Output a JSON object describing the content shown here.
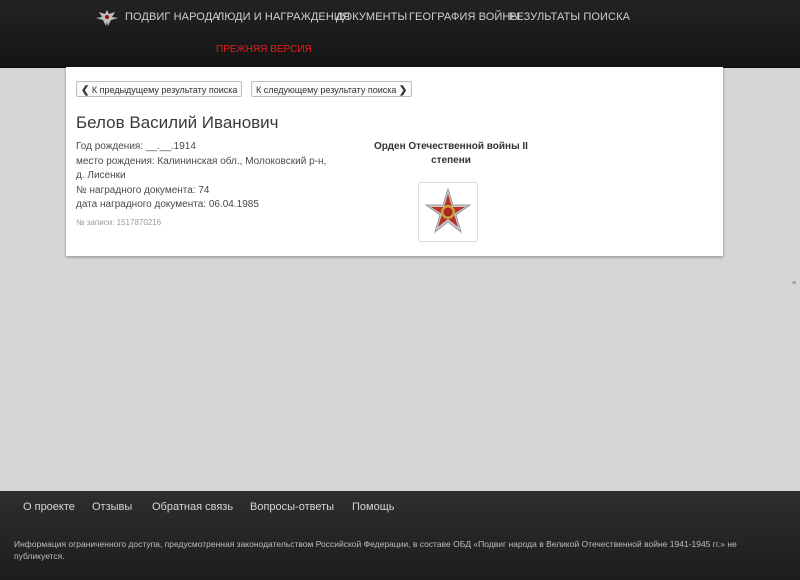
{
  "header": {
    "nav": [
      {
        "label": "ПОДВИГ НАРОДА"
      },
      {
        "label": "ЛЮДИ И НАГРАЖДЕНИЯ"
      },
      {
        "label": "ДОКУМЕНТЫ"
      },
      {
        "label": "ГЕОГРАФИЯ ВОЙНЫ"
      },
      {
        "label": "РЕЗУЛЬТАТЫ ПОИСКА"
      }
    ],
    "prev_version": "ПРЕЖНЯЯ ВЕРСИЯ"
  },
  "pager": {
    "prev_label": "К предыдущему результату поиска",
    "next_label": "К следующему результату поиска"
  },
  "person": {
    "name": "Белов Василий Иванович",
    "info": [
      "Год рождения: __.__.1914",
      "место рождения: Калининская обл., Молоковский р-н, д. Лисенки",
      "№ наградного документа: 74",
      "дата наградного документа: 06.04.1985"
    ],
    "record": "№ записи: 1517870216"
  },
  "award": {
    "title": "Орден Отечественной войны II степени"
  },
  "footer": {
    "links": [
      {
        "label": "О проекте"
      },
      {
        "label": "Отзывы"
      },
      {
        "label": "Обратная связь"
      },
      {
        "label": "Вопросы-ответы"
      },
      {
        "label": "Помощь"
      }
    ],
    "disclaimer": "Информация ограниченного доступа, предусмотренная законодательством Российской Федерации, в составе ОБД «Подвиг народа в Великой Отечественной войне 1941-1945 гг.» не публикуется."
  }
}
